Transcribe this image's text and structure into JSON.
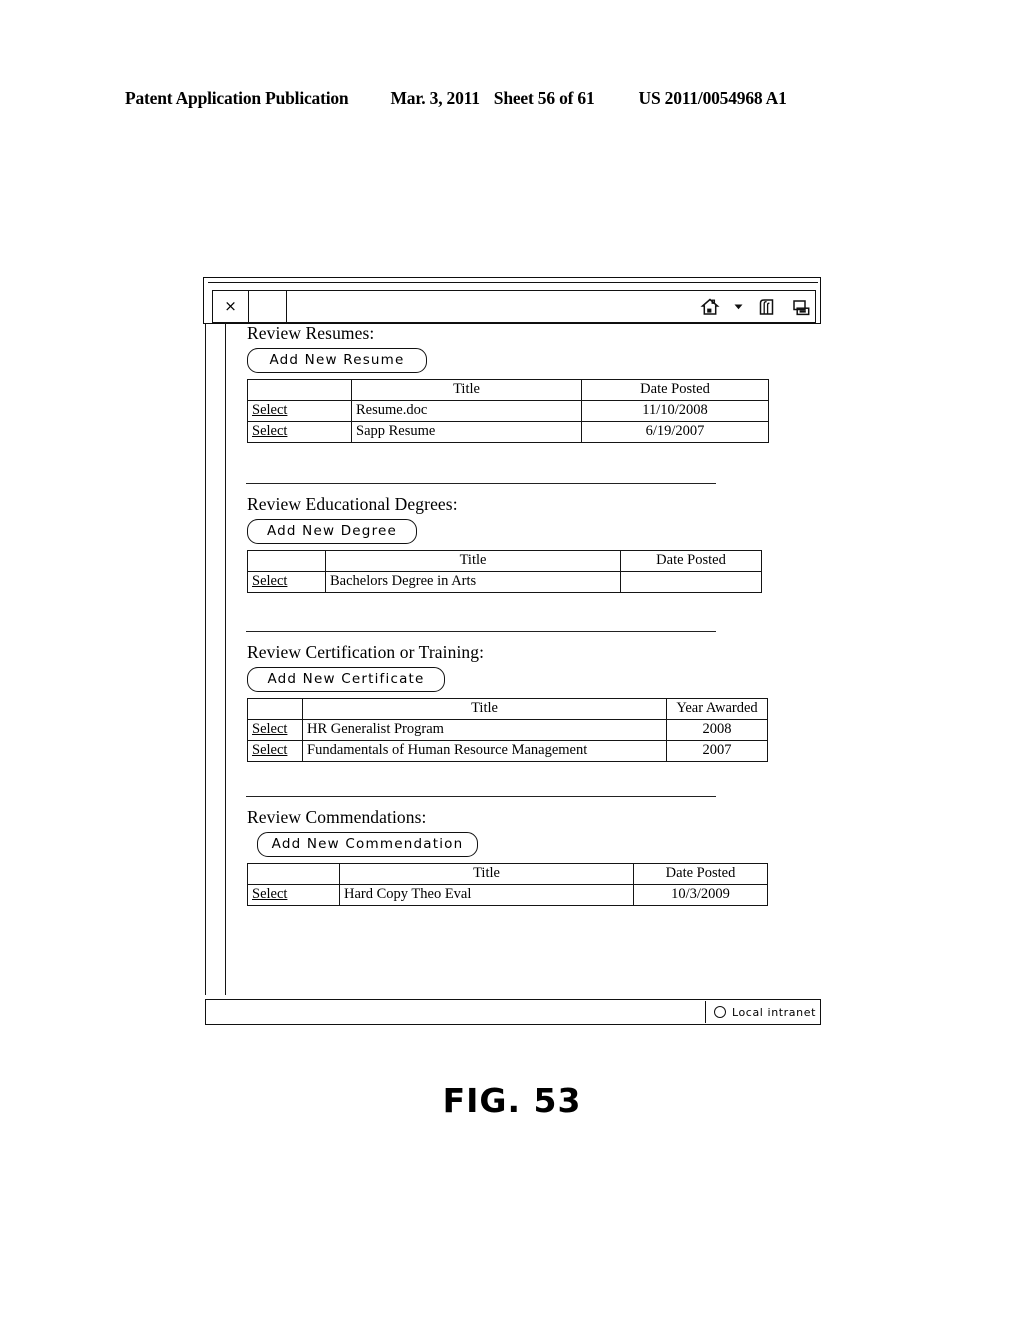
{
  "patent_header": {
    "publication": "Patent Application Publication",
    "date": "Mar. 3, 2011",
    "sheet": "Sheet 56 of 61",
    "number": "US 2011/0054968 A1"
  },
  "figure": {
    "caption": "FIG. 53"
  },
  "browser": {
    "close_label": "×",
    "address_value": "",
    "icons": [
      "home-icon",
      "chevron-down-icon",
      "feeds-icon",
      "print-icon"
    ],
    "status": {
      "zone_icon": "globe-icon",
      "zone_label": "Local intranet"
    }
  },
  "sections": [
    {
      "id": "resumes",
      "title": "Review Resumes:",
      "button_label": "Add  New  Resume",
      "button_width": 180,
      "columns": [
        "",
        "Title",
        "Date Posted"
      ],
      "rows": [
        {
          "select": "Select",
          "title": "Resume.doc",
          "date": "11/10/2008"
        },
        {
          "select": "Select",
          "title": "Sapp Resume",
          "date": "6/19/2007"
        }
      ]
    },
    {
      "id": "degrees",
      "title": "Review Educational Degrees:",
      "button_label": "Add  New  Degree",
      "button_width": 170,
      "columns": [
        "",
        "Title",
        "Date Posted"
      ],
      "rows": [
        {
          "select": "Select",
          "title": "Bachelors Degree in Arts",
          "date": ""
        }
      ]
    },
    {
      "id": "certs",
      "title": "Review Certification or Training:",
      "button_label": "Add  New  Certificate",
      "button_width": 198,
      "columns": [
        "",
        "Title",
        "Year Awarded"
      ],
      "rows": [
        {
          "select": "Select",
          "title": "HR Generalist Program",
          "date": "2008"
        },
        {
          "select": "Select",
          "title": "Fundamentals of Human Resource Management",
          "date": "2007"
        }
      ]
    },
    {
      "id": "commends",
      "title": "Review Commendations:",
      "button_label": "Add  New  Commendation",
      "button_width": 221,
      "columns": [
        "",
        "Title",
        "Date Posted"
      ],
      "rows": [
        {
          "select": "Select",
          "title": "Hard Copy Theo Eval",
          "date": "10/3/2009"
        }
      ]
    }
  ]
}
